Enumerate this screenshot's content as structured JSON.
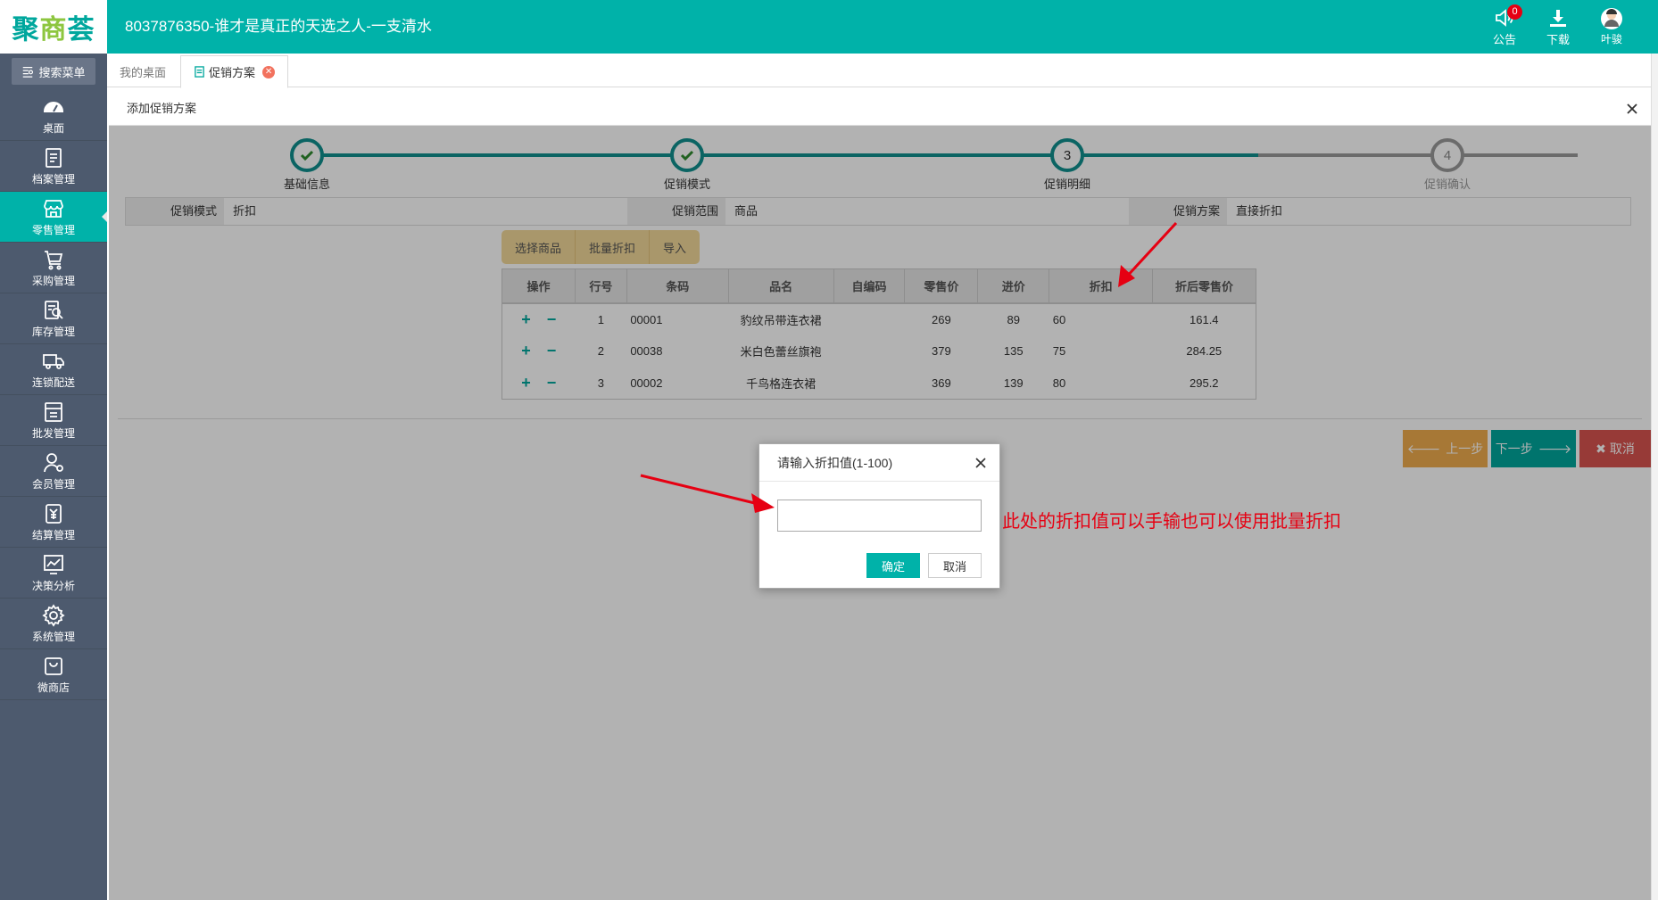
{
  "header": {
    "logo_a": "聚",
    "logo_b": "商",
    "logo_c": "荟",
    "title": "8037876350-谁才是真正的天选之人-一支清水",
    "actions": [
      {
        "label": "公告",
        "icon": "speaker-icon",
        "badge": "0"
      },
      {
        "label": "下载",
        "icon": "download-icon"
      },
      {
        "label": "叶骏",
        "icon": "avatar"
      }
    ]
  },
  "sidebar": {
    "search_label": "搜索菜单",
    "items": [
      {
        "label": "桌面",
        "icon": "dashboard-icon"
      },
      {
        "label": "档案管理",
        "icon": "archive-icon"
      },
      {
        "label": "零售管理",
        "icon": "store-icon",
        "active": true
      },
      {
        "label": "采购管理",
        "icon": "cart-icon"
      },
      {
        "label": "库存管理",
        "icon": "inventory-icon"
      },
      {
        "label": "连锁配送",
        "icon": "truck-icon"
      },
      {
        "label": "批发管理",
        "icon": "wholesale-icon"
      },
      {
        "label": "会员管理",
        "icon": "member-icon"
      },
      {
        "label": "结算管理",
        "icon": "yuan-icon"
      },
      {
        "label": "决策分析",
        "icon": "chart-icon"
      },
      {
        "label": "系统管理",
        "icon": "gear-icon"
      },
      {
        "label": "微商店",
        "icon": "bag-icon"
      }
    ]
  },
  "tabs": [
    {
      "label": "我的桌面"
    },
    {
      "label": "促销方案",
      "active": true
    }
  ],
  "panel": {
    "title": "添加促销方案"
  },
  "stepper": {
    "steps": [
      {
        "label": "基础信息",
        "state": "done"
      },
      {
        "label": "促销模式",
        "state": "done"
      },
      {
        "label": "促销明细",
        "state": "current",
        "number": "3"
      },
      {
        "label": "促销确认",
        "state": "todo",
        "number": "4"
      }
    ]
  },
  "info": {
    "mode_label": "促销模式",
    "mode_value": "折扣",
    "scope_label": "促销范围",
    "scope_value": "商品",
    "plan_label": "促销方案",
    "plan_value": "直接折扣"
  },
  "toolbar": {
    "select_goods": "选择商品",
    "batch_discount": "批量折扣",
    "import": "导入"
  },
  "grid": {
    "columns": [
      "操作",
      "行号",
      "条码",
      "品名",
      "自编码",
      "零售价",
      "进价",
      "折扣",
      "折后零售价"
    ],
    "rows": [
      {
        "line": "1",
        "barcode": "00001",
        "name": "豹纹吊带连衣裙",
        "code": "",
        "retail": "269",
        "cost": "89",
        "discount": "60",
        "after": "161.4"
      },
      {
        "line": "2",
        "barcode": "00038",
        "name": "米白色蕾丝旗袍",
        "code": "",
        "retail": "379",
        "cost": "135",
        "discount": "75",
        "after": "284.25"
      },
      {
        "line": "3",
        "barcode": "00002",
        "name": "千鸟格连衣裙",
        "code": "",
        "retail": "369",
        "cost": "139",
        "discount": "80",
        "after": "295.2"
      }
    ]
  },
  "actions": {
    "prev": "上一步",
    "next": "下一步",
    "cancel": "取消"
  },
  "dialog": {
    "title": "请输入折扣值(1-100)",
    "value": "",
    "ok": "确定",
    "cancel": "取消"
  },
  "annotation": {
    "text": "此处的折扣值可以手输也可以使用批量折扣",
    "color": "#e60012"
  },
  "colors": {
    "brand": "#00b2a9",
    "sidebar": "#4d5a6e",
    "step_done": "#10908f"
  }
}
